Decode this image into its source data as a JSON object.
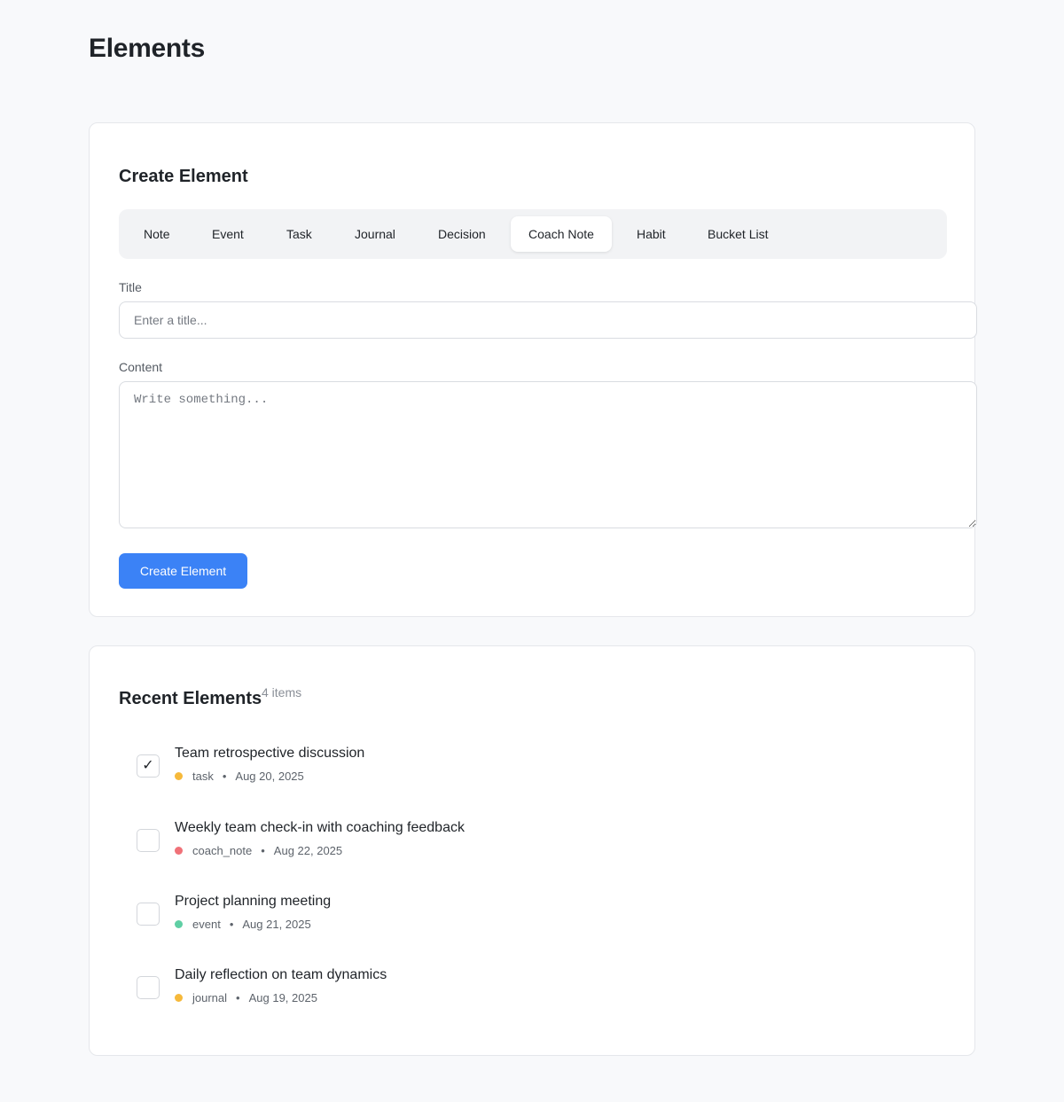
{
  "page": {
    "title": "Elements"
  },
  "create": {
    "heading": "Create Element",
    "tabs": [
      {
        "label": "Note",
        "active": false
      },
      {
        "label": "Event",
        "active": false
      },
      {
        "label": "Task",
        "active": false
      },
      {
        "label": "Journal",
        "active": false
      },
      {
        "label": "Decision",
        "active": false
      },
      {
        "label": "Coach Note",
        "active": true
      },
      {
        "label": "Habit",
        "active": false
      },
      {
        "label": "Bucket List",
        "active": false
      }
    ],
    "title_label": "Title",
    "title_value": "",
    "title_placeholder": "Enter a title...",
    "content_label": "Content",
    "content_value": "",
    "content_placeholder": "Write something...",
    "submit_label": "Create Element"
  },
  "recent": {
    "heading": "Recent Elements",
    "count_label": "4 items",
    "items": [
      {
        "title": "Team retrospective discussion",
        "type": "task",
        "date": "Aug 20, 2025",
        "checked": true,
        "check_mark": "✓",
        "color": "#f6b93b"
      },
      {
        "title": "Weekly team check-in with coaching feedback",
        "type": "coach_note",
        "date": "Aug 22, 2025",
        "checked": false,
        "check_mark": "",
        "color": "#f07178"
      },
      {
        "title": "Project planning meeting",
        "type": "event",
        "date": "Aug 21, 2025",
        "checked": false,
        "check_mark": "",
        "color": "#5fcfa4"
      },
      {
        "title": "Daily reflection on team dynamics",
        "type": "journal",
        "date": "Aug 19, 2025",
        "checked": false,
        "check_mark": "",
        "color": "#f6b93b"
      }
    ],
    "meta_separator": "•"
  },
  "colors": {
    "accent": "#3b82f6",
    "background": "#f8f9fb"
  }
}
